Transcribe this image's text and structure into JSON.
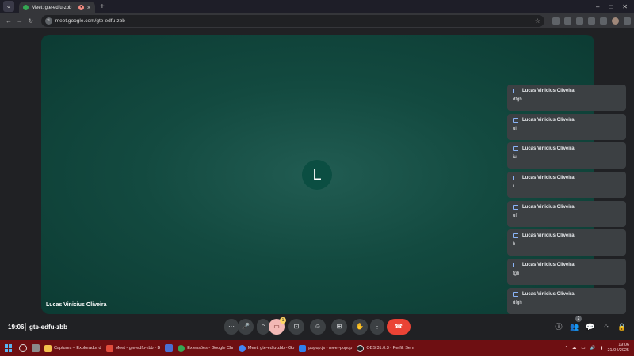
{
  "browser": {
    "tab_title": "Meet: gte-edfu-zbb",
    "new_tab_symbol": "+",
    "url": "meet.google.com/gte-edfu-zbb",
    "window_controls": [
      "–",
      "□",
      "✕"
    ]
  },
  "meeting": {
    "avatar_letter": "L",
    "participant_name": "Lucas Vinicius Oliveira",
    "time": "19:06",
    "code": "gte-edfu-zbb",
    "camera_badge": "1",
    "people_badge": "2"
  },
  "chat_messages": [
    {
      "sender": "Lucas Vinicius Oliveira",
      "text": "dfgh"
    },
    {
      "sender": "Lucas Vinicius Oliveira",
      "text": "ui"
    },
    {
      "sender": "Lucas Vinicius Oliveira",
      "text": "iu"
    },
    {
      "sender": "Lucas Vinicius Oliveira",
      "text": "i"
    },
    {
      "sender": "Lucas Vinicius Oliveira",
      "text": "uf"
    },
    {
      "sender": "Lucas Vinicius Oliveira",
      "text": "h"
    },
    {
      "sender": "Lucas Vinicius Oliveira",
      "text": "fgh"
    },
    {
      "sender": "Lucas Vinicius Oliveira",
      "text": "dfgh"
    }
  ],
  "controls": {
    "more_options": "···",
    "mic": "🎤",
    "chevron_up": "^",
    "camera": "▭",
    "captions": "⊡",
    "emoji": "☺",
    "present": "⊞",
    "raise_hand": "✋",
    "kebab": "⋮",
    "leave": "☎",
    "info": "ⓘ",
    "people": "👥",
    "chat": "💬",
    "activities": "⁘",
    "host_controls": "🔒"
  },
  "taskbar": {
    "apps": [
      {
        "label": "Captures – Explorador d",
        "color": "#f4c04d"
      },
      {
        "label": "Meet - gte-edfu-zbb - B",
        "color": "#e14b3b"
      },
      {
        "label": "Extensões - Google Chr",
        "color": "#34a853"
      },
      {
        "label": "Meet: gte-edfu-zbb - Go",
        "color": "#4285f4"
      },
      {
        "label": "popup.js - meet-popup",
        "color": "#2f80ed"
      },
      {
        "label": "OBS 31.0.3 - Perfil: Sem",
        "color": "#222222"
      }
    ],
    "clock_time": "19:06",
    "clock_date": "21/04/2025"
  },
  "colors": {
    "stage": "#134a40",
    "leave": "#ea4335",
    "taskbar": "#6e0f12"
  }
}
